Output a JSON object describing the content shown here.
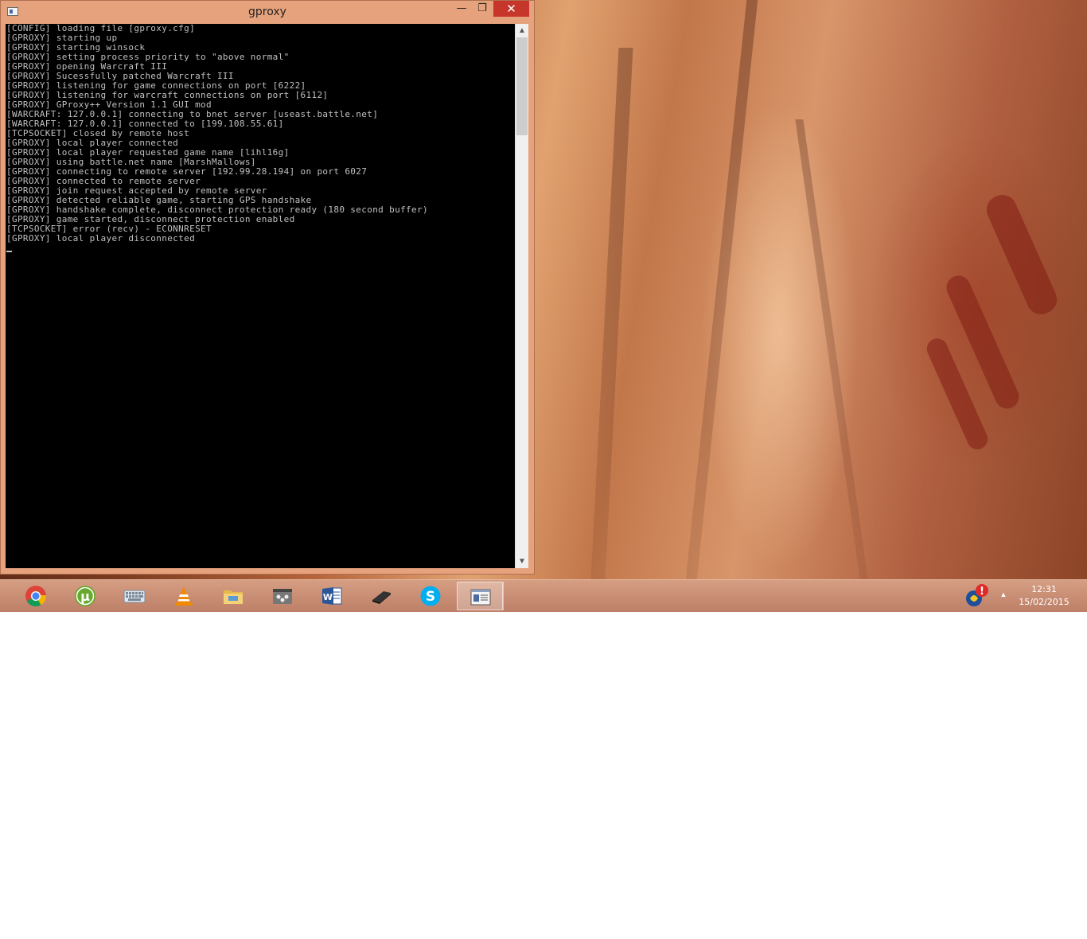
{
  "window": {
    "title": "gproxy",
    "min_glyph": "—",
    "max_glyph": "❐",
    "close_glyph": "✕"
  },
  "console": {
    "lines": [
      "[CONFIG] loading file [gproxy.cfg]",
      "[GPROXY] starting up",
      "[GPROXY] starting winsock",
      "[GPROXY] setting process priority to \"above normal\"",
      "[GPROXY] opening Warcraft III",
      "[GPROXY] Sucessfully patched Warcraft III",
      "[GPROXY] listening for game connections on port [6222]",
      "[GPROXY] listening for warcraft connections on port [6112]",
      "[GPROXY] GProxy++ Version 1.1 GUI mod",
      "[WARCRAFT: 127.0.0.1] connecting to bnet server [useast.battle.net]",
      "[WARCRAFT: 127.0.0.1] connected to [199.108.55.61]",
      "[TCPSOCKET] closed by remote host",
      "[GPROXY] local player connected",
      "[GPROXY] local player requested game name [lihl16g]",
      "[GPROXY] using battle.net name [MarshMallows]",
      "[GPROXY] connecting to remote server [192.99.28.194] on port 6027",
      "[GPROXY] connected to remote server",
      "[GPROXY] join request accepted by remote server",
      "[GPROXY] detected reliable game, starting GPS handshake",
      "[GPROXY] handshake complete, disconnect protection ready (180 second buffer)",
      "[GPROXY] game started, disconnect protection enabled",
      "[TCPSOCKET] error (recv) - ECONNRESET",
      "[GPROXY] local player disconnected"
    ]
  },
  "taskbar": {
    "apps": [
      {
        "name": "chrome-icon",
        "active": true
      },
      {
        "name": "utorrent-icon",
        "active": true
      },
      {
        "name": "keyboard-icon",
        "active": false
      },
      {
        "name": "vlc-icon",
        "active": false
      },
      {
        "name": "file-explorer-icon",
        "active": false
      },
      {
        "name": "video-editor-icon",
        "active": false
      },
      {
        "name": "word-icon",
        "active": false
      },
      {
        "name": "console-device-icon",
        "active": false
      },
      {
        "name": "skype-icon",
        "active": false
      },
      {
        "name": "gproxy-window-icon",
        "active": true
      }
    ],
    "word_letter": "W",
    "skype_letter": "S",
    "utorrent_letter": "µ"
  },
  "tray": {
    "time": "12:31",
    "date": "15/02/2015",
    "warning_glyph": "!",
    "arrow_glyph": "▲"
  },
  "colors": {
    "window_frame": "#e6a27c",
    "close_button": "#c7362b",
    "console_bg": "#000000",
    "console_text": "#c0c0c0"
  }
}
